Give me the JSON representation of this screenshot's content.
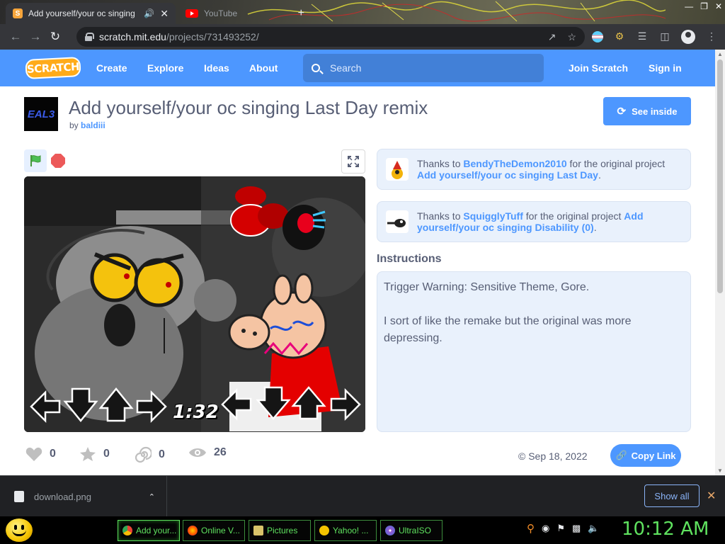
{
  "browser": {
    "tabs": [
      {
        "title": "Add yourself/your oc singing",
        "active": true
      },
      {
        "title": "YouTube",
        "active": false
      }
    ],
    "url_host": "scratch.mit.edu",
    "url_path": "/projects/731493252/"
  },
  "site": {
    "logo": "SCRATCH",
    "nav": [
      "Create",
      "Explore",
      "Ideas",
      "About"
    ],
    "search_placeholder": "Search",
    "join": "Join Scratch",
    "signin": "Sign in"
  },
  "project": {
    "thumb_text": "EAL3",
    "title": "Add yourself/your oc singing Last Day remix",
    "by_label": "by",
    "author": "baldiii",
    "see_inside": "See inside",
    "timer": "1:32",
    "credits": [
      {
        "prefix": "Thanks to",
        "user": "BendyTheDemon2010",
        "middle": "for the original project",
        "project": "Add yourself/your oc singing Last Day",
        "suffix": "."
      },
      {
        "prefix": "Thanks to",
        "user": "SquigglyTuff",
        "middle": "for the original project",
        "project": "Add yourself/your oc singing Disability (0)",
        "suffix": "."
      }
    ],
    "instructions_heading": "Instructions",
    "instructions": "Trigger Warning: Sensitive Theme, Gore.\n\nI sort of like the remake but the original was more depressing.",
    "stats": {
      "loves": "0",
      "favorites": "0",
      "remixes": "0",
      "views": "26"
    },
    "date": "Sep 18, 2022",
    "copy_link": "Copy Link"
  },
  "downloads": {
    "file": "download.png",
    "show_all": "Show all"
  },
  "taskbar": {
    "items": [
      "Add your...",
      "Online V...",
      "Pictures",
      "Yahoo! ...",
      "UltraISO"
    ],
    "clock": "10:12 AM"
  },
  "colors": {
    "scratch_blue": "#4d97ff",
    "scratch_orange": "#ffab19",
    "text": "#575e75",
    "taskbar_green": "#5fe25f"
  }
}
